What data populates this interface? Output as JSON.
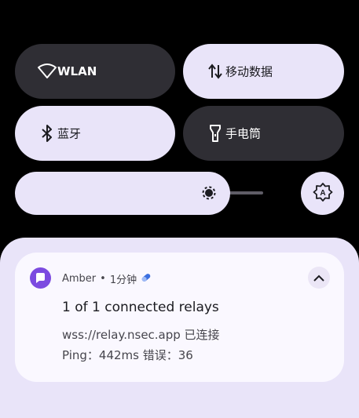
{
  "quick_settings": {
    "tiles": [
      {
        "label": "WLAN",
        "icon": "wifi-icon",
        "active": false
      },
      {
        "label": "移动数据",
        "icon": "mobile-data-icon",
        "active": true
      },
      {
        "label": "蓝牙",
        "icon": "bluetooth-icon",
        "active": true
      },
      {
        "label": "手电筒",
        "icon": "flashlight-icon",
        "active": false
      }
    ],
    "brightness": {
      "icon": "brightness-icon",
      "level": 0.8,
      "auto_icon": "auto-brightness-icon"
    }
  },
  "notification": {
    "app_name": "Amber",
    "separator": "•",
    "time": "1分钟",
    "app_icon": "amber-app-icon",
    "extra_icon": "pill-icon",
    "title": "1 of 1 connected relays",
    "line1": "wss://relay.nsec.app 已连接",
    "line2": "Ping：442ms 错误：36",
    "expand_icon": "chevron-up-icon"
  },
  "colors": {
    "background": "#000000",
    "tile_active": "#e9e4f9",
    "tile_inactive": "#2f2e34",
    "accent": "#7c4be0"
  }
}
